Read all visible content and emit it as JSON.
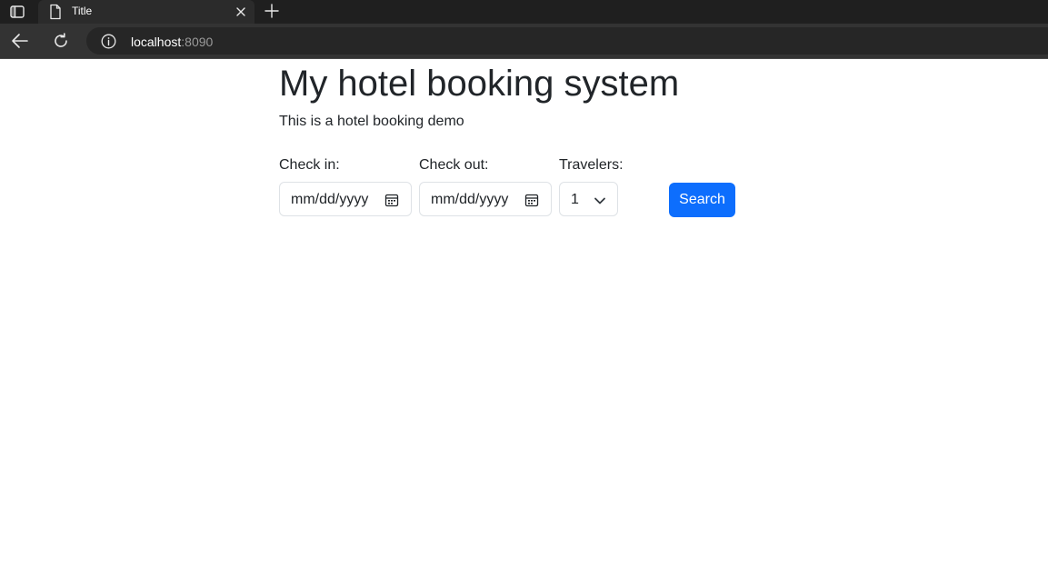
{
  "browser": {
    "tab": {
      "title": "Title"
    },
    "address": {
      "host": "localhost",
      "port": ":8090"
    },
    "icons": {
      "sidebar": "sidebar-toggle-icon",
      "tab_page": "page-icon",
      "tab_close": "close-icon",
      "new_tab": "plus-icon",
      "back": "back-arrow-icon",
      "reload": "reload-icon",
      "site_info": "info-icon"
    }
  },
  "page": {
    "title": "My hotel booking system",
    "subtitle": "This is a hotel booking demo",
    "form": {
      "checkin": {
        "label": "Check in:",
        "placeholder": "mm/dd/yyyy",
        "icon": "calendar-icon"
      },
      "checkout": {
        "label": "Check out:",
        "placeholder": "mm/dd/yyyy",
        "icon": "calendar-icon"
      },
      "travelers": {
        "label": "Travelers:",
        "value": "1",
        "icon": "chevron-down-icon"
      },
      "search_label": "Search"
    }
  },
  "colors": {
    "primary": "#0d6efd",
    "text": "#212529",
    "chrome_dark": "#1f1f1f",
    "toolbar": "#333333"
  }
}
